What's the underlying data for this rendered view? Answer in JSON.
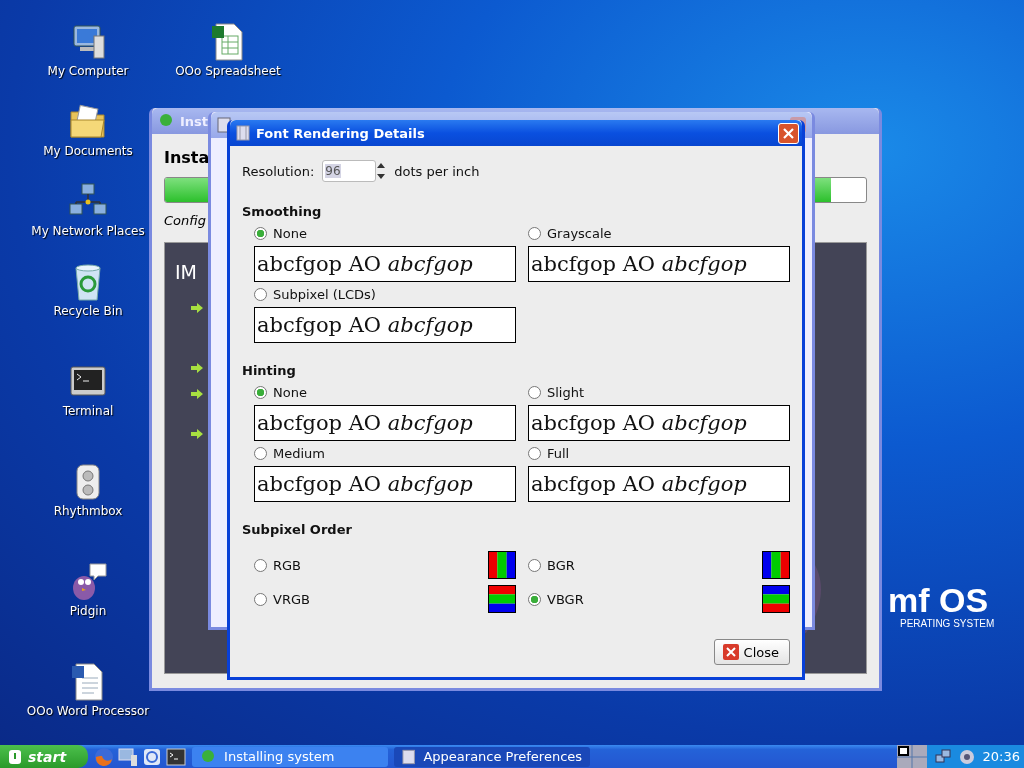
{
  "desktop_icons": [
    {
      "label": "My Computer",
      "kind": "computer"
    },
    {
      "label": "OOo Spreadsheet",
      "kind": "spreadsheet"
    },
    {
      "label": "My Documents",
      "kind": "documents"
    },
    {
      "label": "My Network Places",
      "kind": "network"
    },
    {
      "label": "Recycle Bin",
      "kind": "recycle"
    },
    {
      "label": "Terminal",
      "kind": "terminal"
    },
    {
      "label": "Rhythmbox",
      "kind": "rhythmbox"
    },
    {
      "label": "Pidgin",
      "kind": "pidgin"
    },
    {
      "label": "OOo Word Processor",
      "kind": "writer"
    }
  ],
  "wallpaper_logo": {
    "title": "mf OS",
    "subtitle": "PERATING SYSTEM"
  },
  "installer_window": {
    "title": "Inst",
    "heading": "Insta",
    "progress": {
      "level": 0.95
    },
    "status": "Config",
    "panel_title": "IM"
  },
  "dialog": {
    "title": "Font Rendering Details",
    "resolution": {
      "label": "Resolution:",
      "value": "96",
      "unit": "dots per inch"
    },
    "sections": [
      {
        "heading": "Smoothing",
        "options": [
          {
            "label": "None",
            "selected": true,
            "sample": "abcfgop AO *abcfgop*"
          },
          {
            "label": "Grayscale",
            "selected": false,
            "sample": "abcfgop AO *abcfgop*"
          },
          {
            "label": "Subpixel (LCDs)",
            "selected": false,
            "sample": "abcfgop AO *abcfgop*"
          }
        ]
      },
      {
        "heading": "Hinting",
        "options": [
          {
            "label": "None",
            "selected": true,
            "sample": "abcfgop AO *abcfgop*"
          },
          {
            "label": "Slight",
            "selected": false,
            "sample": "abcfgop AO *abcfgop*"
          },
          {
            "label": "Medium",
            "selected": false,
            "sample": "abcfgop AO *abcfgop*"
          },
          {
            "label": "Full",
            "selected": false,
            "sample": "abcfgop AO *abcfgop*"
          }
        ]
      }
    ],
    "subpixel_order": {
      "heading": "Subpixel Order",
      "options": [
        {
          "label": "RGB",
          "selected": false,
          "kind": "rgb"
        },
        {
          "label": "BGR",
          "selected": false,
          "kind": "bgr"
        },
        {
          "label": "VRGB",
          "selected": false,
          "kind": "vrgb"
        },
        {
          "label": "VBGR",
          "selected": true,
          "kind": "vbgr"
        }
      ]
    },
    "close_button": "Close"
  },
  "taskbar": {
    "start": "start",
    "quick_launch": [
      {
        "kind": "firefox"
      },
      {
        "kind": "computer"
      },
      {
        "kind": "browser"
      },
      {
        "kind": "terminal"
      }
    ],
    "tasks": [
      {
        "label": "Installing system",
        "kind": "installer",
        "selected": false
      },
      {
        "label": "Appearance Preferences",
        "kind": "preferences",
        "selected": true
      }
    ],
    "clock": "20:36"
  }
}
